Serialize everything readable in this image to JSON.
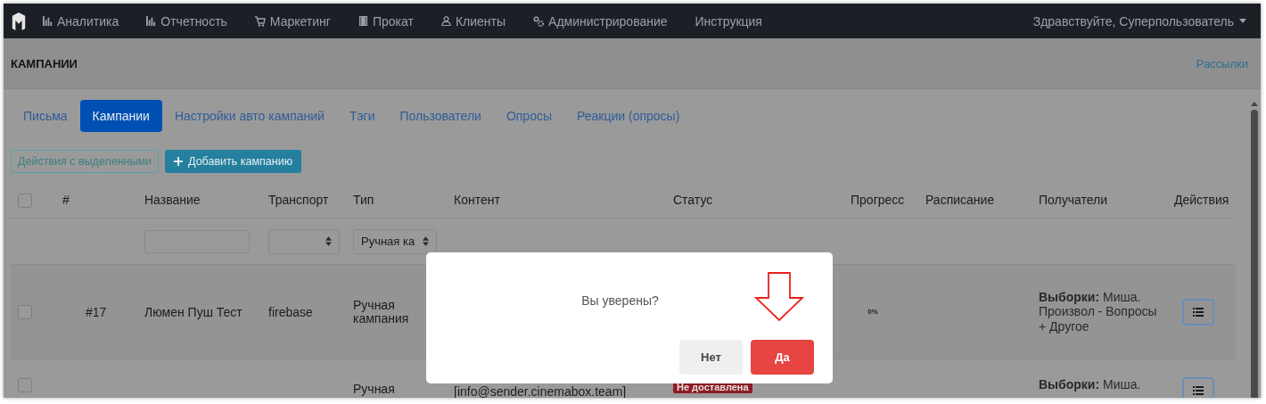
{
  "navbar": {
    "items": [
      {
        "label": "Аналитика"
      },
      {
        "label": "Отчетность"
      },
      {
        "label": "Маркетинг"
      },
      {
        "label": "Прокат"
      },
      {
        "label": "Клиенты"
      },
      {
        "label": "Администрирование"
      },
      {
        "label": "Инструкция"
      }
    ],
    "user": "Здравствуйте, Суперпользователь"
  },
  "header": {
    "title": "КАМПАНИИ",
    "link": "Рассылки"
  },
  "tabs": [
    {
      "label": "Письма",
      "selected": false
    },
    {
      "label": "Кампании",
      "selected": true
    },
    {
      "label": "Настройки авто кампаний",
      "selected": false
    },
    {
      "label": "Тэги",
      "selected": false
    },
    {
      "label": "Пользователи",
      "selected": false
    },
    {
      "label": "Опросы",
      "selected": false
    },
    {
      "label": "Реакции (опросы)",
      "selected": false
    }
  ],
  "toolbar": {
    "bulk": "Действия с выделенными",
    "add": "Добавить кампанию"
  },
  "table": {
    "select_all": false,
    "columns": [
      "#",
      "Название",
      "Транспорт",
      "Тип",
      "Контент",
      "Статус",
      "Прогресс",
      "Расписание",
      "Получатели",
      "Действия"
    ],
    "filters": [
      {
        "kind": "text"
      },
      {
        "kind": "select"
      },
      {
        "kind": "select",
        "value": "Ручная ка"
      }
    ],
    "rows": [
      {
        "checked": false,
        "highlighted": true,
        "number": "#17",
        "name": "Люмен Пуш Тест",
        "transport": "firebase",
        "type": "Ручная кампания",
        "progress": "0%",
        "recipients": "**Выборки:** Миша. Произвол - Вопросы + Другое"
      },
      {
        "checked": false,
        "highlighted": false,
        "type": "Ручная",
        "content": "[info@sender.cinemabox.team]",
        "status": "Не доставлена",
        "recipients": "**Выборки:** Миша."
      }
    ]
  },
  "modal": {
    "message": "Вы уверены?",
    "buttons": [
      {
        "label": "Нет",
        "kind": "secondary"
      },
      {
        "label": "Да",
        "kind": "danger"
      }
    ]
  }
}
